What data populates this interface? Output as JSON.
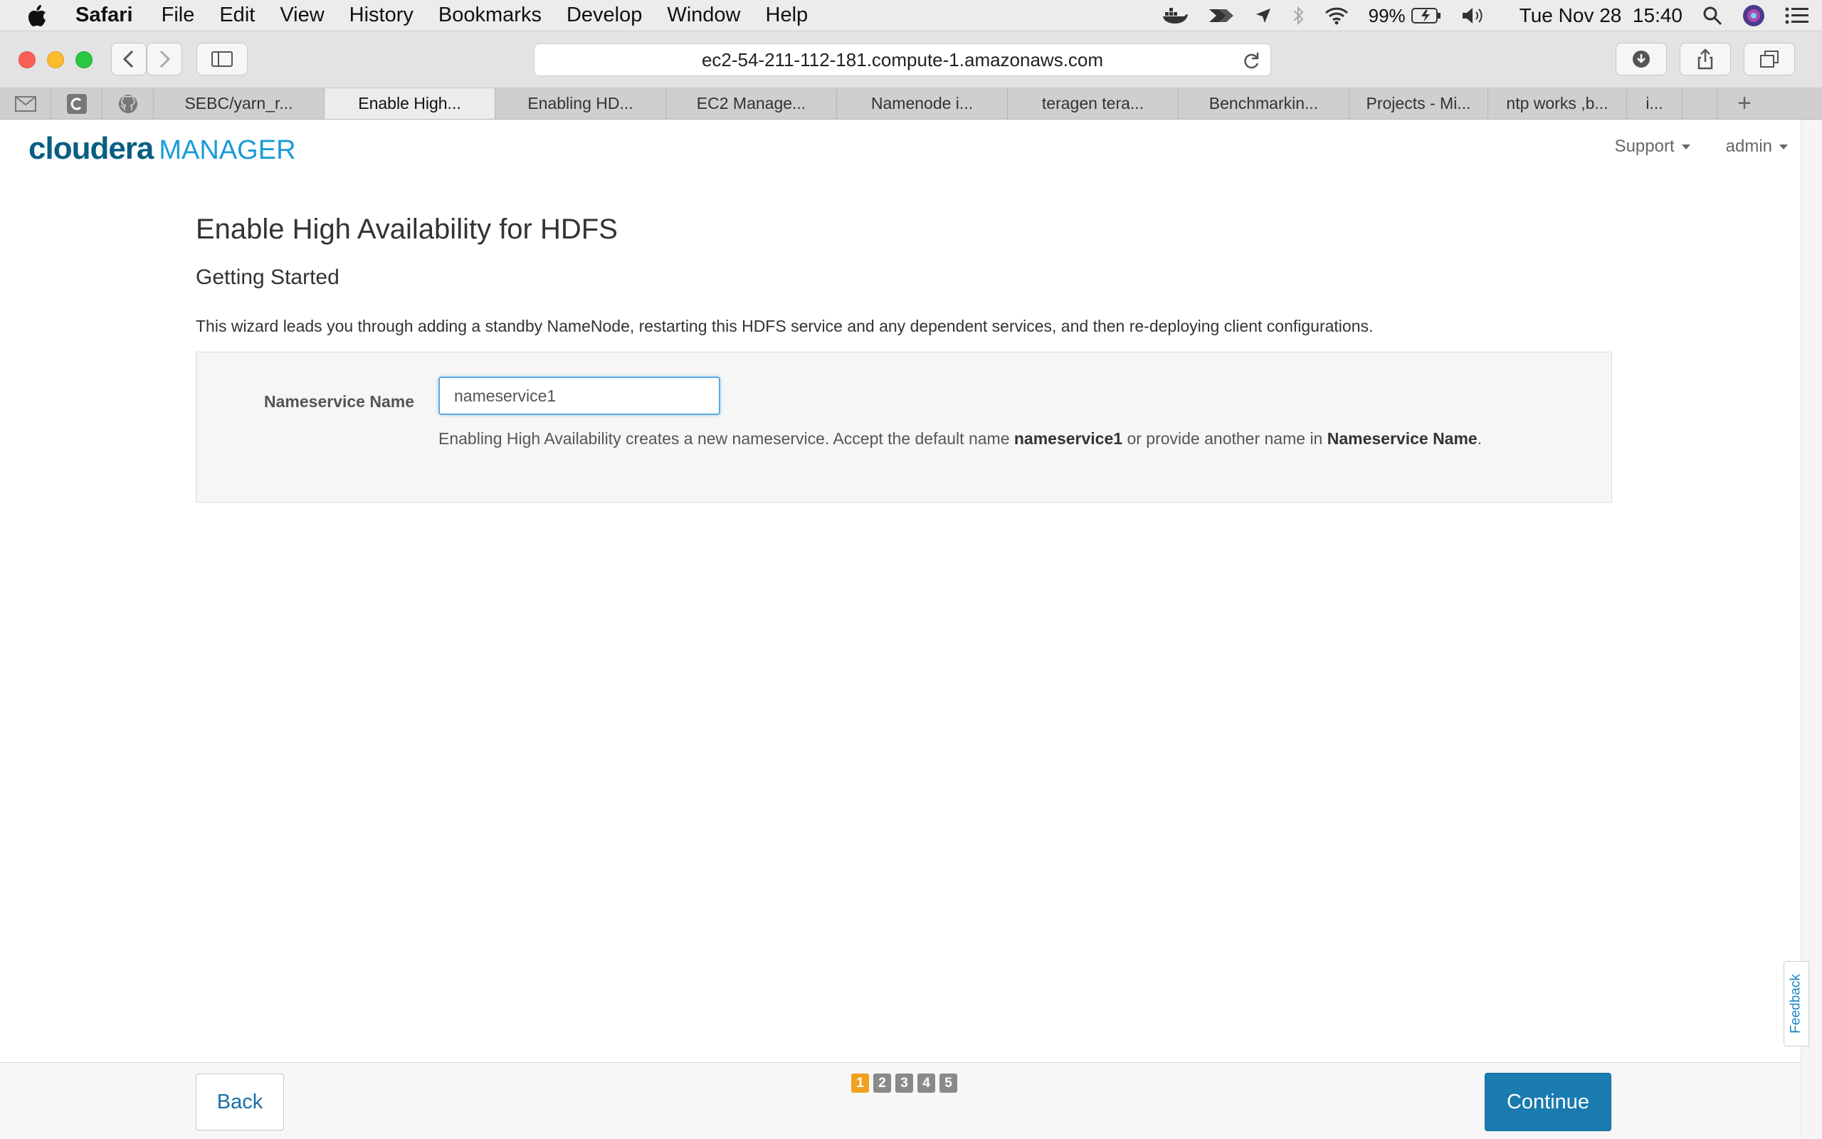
{
  "menubar": {
    "apple_icon": "apple-logo-icon",
    "app_name": "Safari",
    "items": [
      "File",
      "Edit",
      "View",
      "History",
      "Bookmarks",
      "Develop",
      "Window",
      "Help"
    ],
    "battery": "99%",
    "datetime": "Tue Nov 28  15:40"
  },
  "browser": {
    "url": "ec2-54-211-112-181.compute-1.amazonaws.com",
    "tabs": [
      {
        "label": "SEBC/yarn_r..."
      },
      {
        "label": "Enable High..."
      },
      {
        "label": "Enabling HD..."
      },
      {
        "label": "EC2 Manage..."
      },
      {
        "label": "Namenode i..."
      },
      {
        "label": "teragen tera..."
      },
      {
        "label": "Benchmarkin..."
      },
      {
        "label": "Projects - Mi..."
      },
      {
        "label": "ntp works ,b..."
      },
      {
        "label": "i..."
      }
    ],
    "new_tab_label": "+"
  },
  "header": {
    "logo_main": "cloudera",
    "logo_sub": "MANAGER",
    "support_label": "Support",
    "user_label": "admin"
  },
  "page": {
    "title": "Enable High Availability for HDFS",
    "subtitle": "Getting Started",
    "description": "This wizard leads you through adding a standby NameNode, restarting this HDFS service and any dependent services, and then re-deploying client configurations."
  },
  "form": {
    "label": "Nameservice Name",
    "value": "nameservice1",
    "help_prefix": "Enabling High Availability creates a new nameservice. Accept the default name ",
    "help_bold1": "nameservice1",
    "help_middle": " or provide another name in ",
    "help_bold2": "Nameservice Name",
    "help_suffix": "."
  },
  "feedback_label": "Feedback",
  "footer": {
    "back_label": "Back",
    "continue_label": "Continue",
    "steps": [
      "1",
      "2",
      "3",
      "4",
      "5"
    ],
    "current_step": 1
  },
  "colors": {
    "accent": "#1a7bb0",
    "current_step": "#f0a21f",
    "logo_dark": "#0a5e84",
    "logo_light": "#1a9bd7"
  }
}
